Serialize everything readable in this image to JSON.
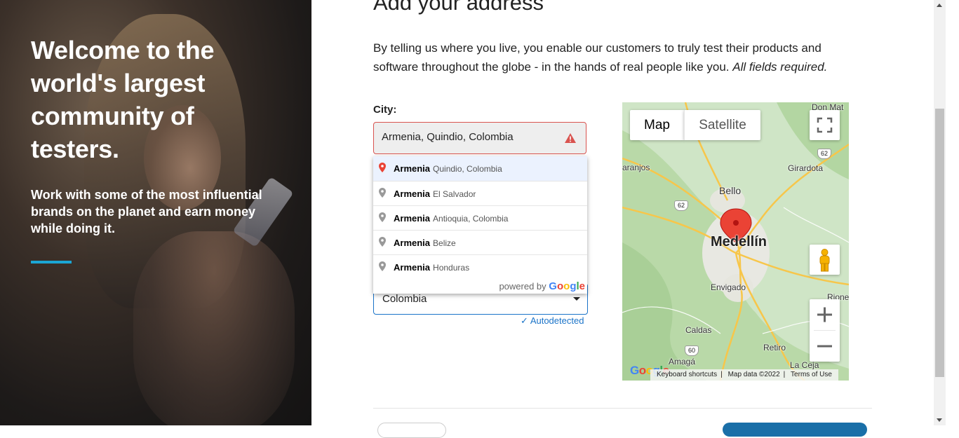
{
  "hero": {
    "title": "Welcome to the world's largest community of testers.",
    "subtitle": "Work with some of the most influential brands on the planet and earn money while doing it."
  },
  "form": {
    "heading": "Add your address",
    "intro": "By telling us where you live, you enable our customers to truly test their products and software throughout the globe - in the hands of real people like you.",
    "intro_required": "All fields required.",
    "city_label": "City:",
    "city_value": "Armenia, Quindio, Colombia",
    "city_status": "error",
    "country_value": "Colombia",
    "autodetected": "Autodetected"
  },
  "autocomplete": {
    "items": [
      {
        "main": "Armenia",
        "secondary": "Quindio, Colombia",
        "highlighted": true
      },
      {
        "main": "Armenia",
        "secondary": "El Salvador",
        "highlighted": false
      },
      {
        "main": "Armenia",
        "secondary": "Antioquia, Colombia",
        "highlighted": false
      },
      {
        "main": "Armenia",
        "secondary": "Belize",
        "highlighted": false
      },
      {
        "main": "Armenia",
        "secondary": "Honduras",
        "highlighted": false
      }
    ],
    "powered_by": "powered by",
    "google": "Google"
  },
  "map": {
    "type_map": "Map",
    "type_satellite": "Satellite",
    "labels": {
      "don_mat": "Don Mat",
      "laranjos": "aranjos",
      "girardota": "Girardota",
      "bello": "Bello",
      "medellin": "Medellín",
      "envigado": "Envigado",
      "caldas": "Caldas",
      "retiro": "Retiro",
      "amaga": "Amagá",
      "la_ceja": "La Ceja",
      "rione": "Rione"
    },
    "shields": {
      "r62a": "62",
      "r62b": "62",
      "r60": "60"
    },
    "zoom_in": "+",
    "zoom_out": "−",
    "footer": {
      "shortcuts": "Keyboard shortcuts",
      "data": "Map data ©2022",
      "terms": "Terms of Use"
    },
    "logo": "Google"
  },
  "colors": {
    "accent": "#1ba6d4",
    "error": "#d9534f",
    "link": "#1a73c8",
    "marker": "#ea4335"
  }
}
